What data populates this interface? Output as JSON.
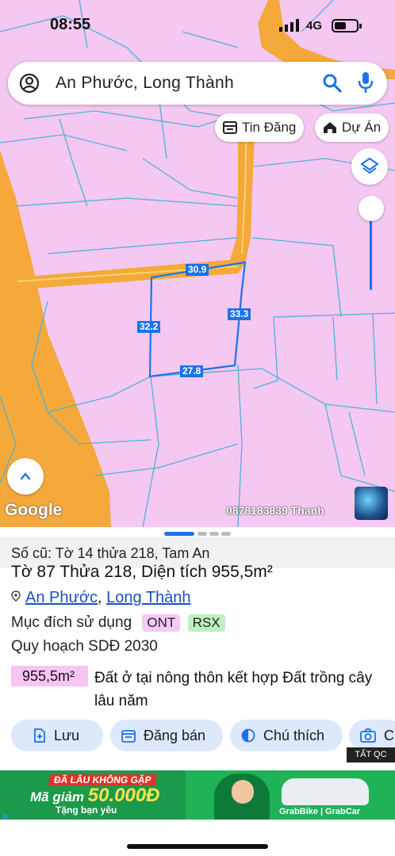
{
  "status_bar": {
    "time": "08:55",
    "network": "4G"
  },
  "search": {
    "query": "An Phước, Long Thành"
  },
  "map_chips": {
    "listings": "Tin Đăng",
    "projects": "Dự Án"
  },
  "map": {
    "measurements": {
      "top": "30.9",
      "right": "33.3",
      "bottom": "27.8",
      "left": "32.2"
    },
    "google_logo": "Google",
    "watermark": "0878183839 Thanh"
  },
  "parcel": {
    "old_id": "Số cũ: Tờ 14 thửa 218, Tam An",
    "title": "Tờ 87 Thửa 218, Diện tích 955,5m²",
    "ward": "An Phước",
    "district": "Long Thành",
    "usage_label": "Mục đích sử dụng",
    "usage_tags": [
      {
        "code": "ONT",
        "color": "#f8c8f6"
      },
      {
        "code": "RSX",
        "color": "#bff0bf"
      }
    ],
    "plan_label": "Quy hoạch SDĐ 2030",
    "area_value": "955,5m²",
    "area_description": "Đất ở tại nông thôn kết hợp Đất trồng cây lâu năm"
  },
  "actions": {
    "save": "Lưu",
    "post": "Đăng bán",
    "legend": "Chú thích",
    "photo": "C"
  },
  "ad": {
    "badge": "TẤT QC",
    "line1": "ĐÃ LÂU KHÔNG GẶP",
    "line2_prefix": "Mã giảm",
    "line2_amount": "50.000Đ",
    "line3": "Tặng bạn yêu",
    "brand": "GrabBike | GrabCar"
  },
  "colors": {
    "accent": "#1a73e8",
    "map_pink": "#f4c8f1",
    "road_orange": "#f4a93a",
    "button_bg": "#dde8fb"
  }
}
